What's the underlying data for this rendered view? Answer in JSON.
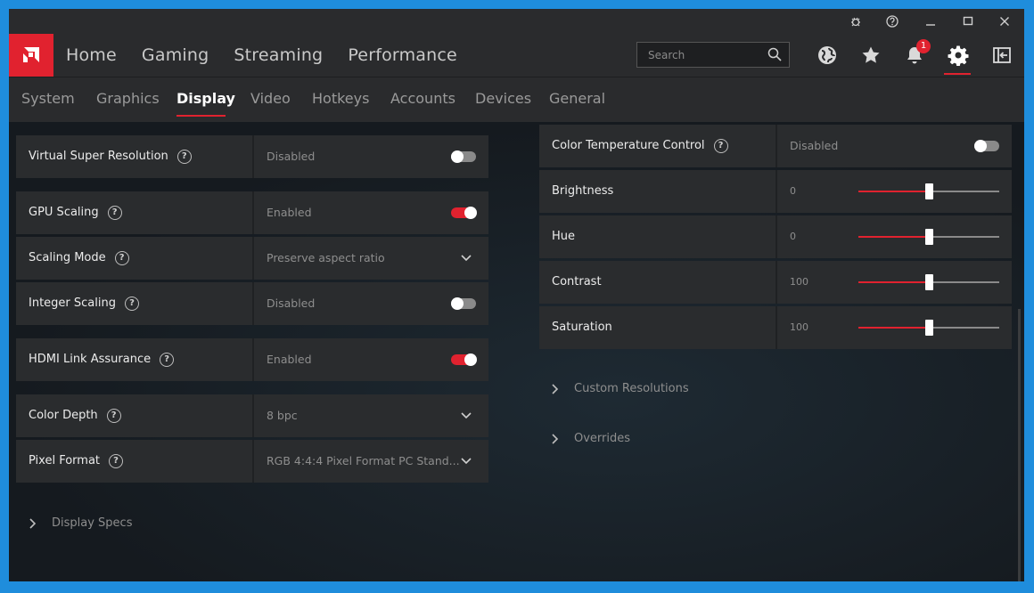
{
  "window_controls": [
    "bug-report-icon",
    "help-icon",
    "minimize-icon",
    "maximize-icon",
    "close-icon"
  ],
  "main_nav": [
    {
      "label": "Home"
    },
    {
      "label": "Gaming"
    },
    {
      "label": "Streaming"
    },
    {
      "label": "Performance"
    }
  ],
  "search": {
    "placeholder": "Search"
  },
  "notifications": {
    "count": "1"
  },
  "sub_nav": [
    {
      "label": "System"
    },
    {
      "label": "Graphics"
    },
    {
      "label": "Display",
      "active": true
    },
    {
      "label": "Video"
    },
    {
      "label": "Hotkeys"
    },
    {
      "label": "Accounts"
    },
    {
      "label": "Devices"
    },
    {
      "label": "General"
    }
  ],
  "left_settings": {
    "vsr": {
      "label": "Virtual Super Resolution",
      "value": "Disabled",
      "on": false
    },
    "gpu_scaling": {
      "label": "GPU Scaling",
      "value": "Enabled",
      "on": true
    },
    "scaling_mode": {
      "label": "Scaling Mode",
      "value": "Preserve aspect ratio"
    },
    "integer_scaling": {
      "label": "Integer Scaling",
      "value": "Disabled",
      "on": false
    },
    "hdmi_link": {
      "label": "HDMI Link Assurance",
      "value": "Enabled",
      "on": true
    },
    "color_depth": {
      "label": "Color Depth",
      "value": "8 bpc"
    },
    "pixel_format": {
      "label": "Pixel Format",
      "value": "RGB 4:4:4 Pixel Format PC Stand..."
    },
    "display_specs": {
      "label": "Display Specs"
    }
  },
  "right_settings": {
    "color_temp": {
      "label": "Color Temperature Control",
      "value": "Disabled",
      "on": false
    },
    "brightness": {
      "label": "Brightness",
      "value": "0",
      "level": 0.5
    },
    "hue": {
      "label": "Hue",
      "value": "0",
      "level": 0.5
    },
    "contrast": {
      "label": "Contrast",
      "value": "100",
      "level": 0.5
    },
    "saturation": {
      "label": "Saturation",
      "value": "100",
      "level": 0.5
    },
    "custom_resolutions": {
      "label": "Custom Resolutions"
    },
    "overrides": {
      "label": "Overrides"
    }
  },
  "colors": {
    "accent": "#e1222f",
    "panel": "#2a2c2e",
    "background": "#161a1e"
  }
}
